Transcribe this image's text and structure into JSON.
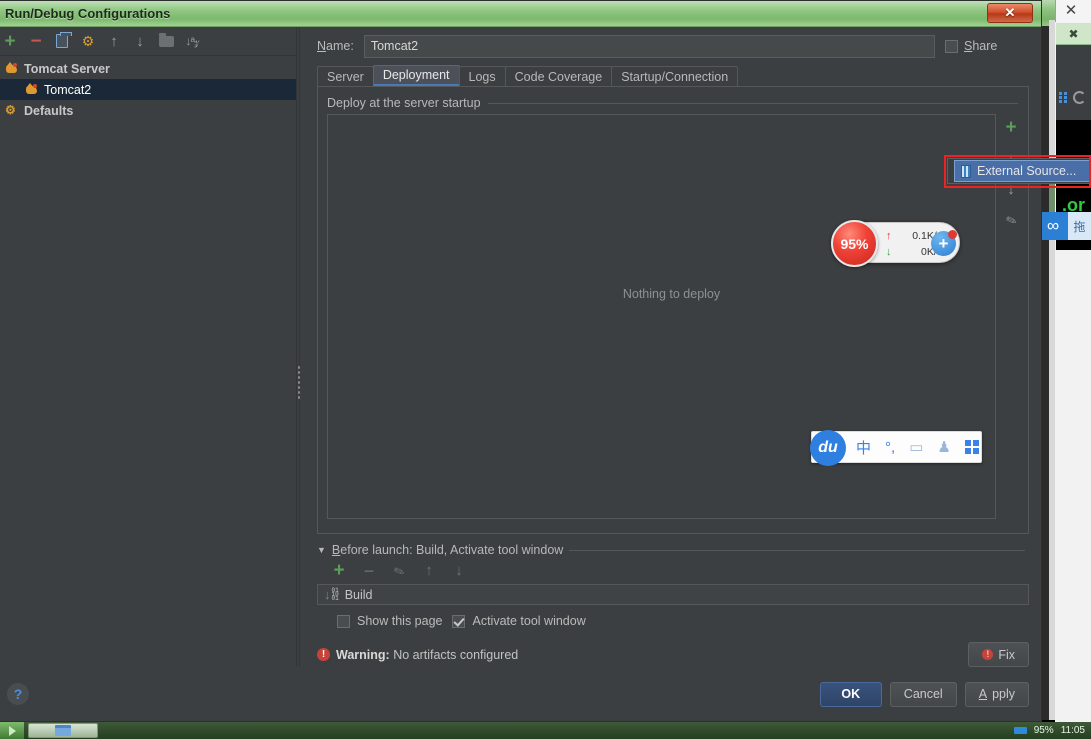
{
  "window": {
    "title": "Run/Debug Configurations",
    "close_label": "✕"
  },
  "left_toolbar": {
    "items": [
      {
        "name": "add",
        "glyph": "+"
      },
      {
        "name": "remove",
        "glyph": "−"
      },
      {
        "name": "copy",
        "glyph": ""
      },
      {
        "name": "settings",
        "glyph": ""
      },
      {
        "name": "move-up",
        "glyph": "↑"
      },
      {
        "name": "move-down",
        "glyph": "↓"
      },
      {
        "name": "folder",
        "glyph": ""
      },
      {
        "name": "sort-alphabetically",
        "glyph": "↓az"
      }
    ]
  },
  "tree": {
    "items": [
      {
        "label": "Tomcat Server",
        "icon": "tomcat-icon",
        "level": 1,
        "bold": true,
        "selected": false
      },
      {
        "label": "Tomcat2",
        "icon": "tomcat-icon",
        "level": 2,
        "bold": false,
        "selected": true
      },
      {
        "label": "Defaults",
        "icon": "gear-icon",
        "level": 1,
        "bold": true,
        "selected": false
      }
    ]
  },
  "name_row": {
    "label": "Name:",
    "label_mnemonic": "N",
    "label_rest": "ame:",
    "value": "Tomcat2",
    "share_label": "Share",
    "share_mnemonic": "S",
    "share_rest": "hare",
    "share_checked": false
  },
  "tabs": [
    {
      "label": "Server",
      "active": false
    },
    {
      "label": "Deployment",
      "active": true
    },
    {
      "label": "Logs",
      "active": false
    },
    {
      "label": "Code Coverage",
      "active": false
    },
    {
      "label": "Startup/Connection",
      "active": false
    }
  ],
  "deployment": {
    "section_title": "Deploy at the server startup",
    "empty_text": "Nothing to deploy",
    "side_buttons": [
      {
        "name": "add-artifact",
        "glyph": "+"
      },
      {
        "name": "move-up",
        "glyph": "↑"
      },
      {
        "name": "move-down",
        "glyph": "↓"
      },
      {
        "name": "edit",
        "glyph": "✎"
      }
    ]
  },
  "external_popup": {
    "item_label": "External Source...",
    "icon": "external-source-icon",
    "highlighted": true
  },
  "before_launch": {
    "header": "Before launch: Build, Activate tool window",
    "header_mnemonic": "B",
    "header_rest": "efore launch: Build, Activate tool window",
    "toolbar": [
      {
        "name": "add",
        "glyph": "+"
      },
      {
        "name": "remove",
        "glyph": "−"
      },
      {
        "name": "edit",
        "glyph": "✎"
      },
      {
        "name": "move-up",
        "glyph": "↑"
      },
      {
        "name": "move-down",
        "glyph": "↓"
      }
    ],
    "rows": [
      {
        "label": "Build",
        "icon": "build-icon"
      }
    ],
    "checkboxes": [
      {
        "label": "Show this page",
        "checked": false
      },
      {
        "label": "Activate tool window",
        "checked": true
      }
    ]
  },
  "warning": {
    "prefix": "Warning:",
    "message": "No artifacts configured",
    "fix_label": "Fix",
    "icon": "!"
  },
  "footer": {
    "help_label": "?",
    "buttons": [
      {
        "label": "OK",
        "primary": true,
        "mnemonic": ""
      },
      {
        "label": "Cancel",
        "primary": false,
        "mnemonic": ""
      },
      {
        "label": "Apply",
        "primary": false,
        "mnemonic": "A"
      }
    ]
  },
  "net_widget": {
    "percent": "95%",
    "upload": "0.1K/s",
    "download": "0K/s",
    "upload_arrow": "↑",
    "download_arrow": "↓",
    "badge": "+"
  },
  "ime_bar": {
    "logo": "du",
    "items": [
      {
        "name": "chinese-mode-icon",
        "glyph": "中"
      },
      {
        "name": "punctuation-icon",
        "glyph": "°,"
      },
      {
        "name": "toolbox-icon",
        "glyph": "▭"
      },
      {
        "name": "user-icon",
        "glyph": "☻"
      },
      {
        "name": "apps-grid-icon",
        "glyph": ""
      }
    ]
  },
  "background": {
    "terminal_text": ".or",
    "blue_badge_glyph": "∞",
    "blue_label_glyph": "拖",
    "right_close": "✕",
    "right_tab_glyph": "✖"
  },
  "taskbar": {
    "percent": "95%",
    "clock": "11:05"
  },
  "colors": {
    "accent_blue": "#4a6ea8",
    "title_green": "#8fc683",
    "warning_red": "#c7433a",
    "plus_green": "#5a9e5a",
    "annotation_red": "#ee2222"
  }
}
